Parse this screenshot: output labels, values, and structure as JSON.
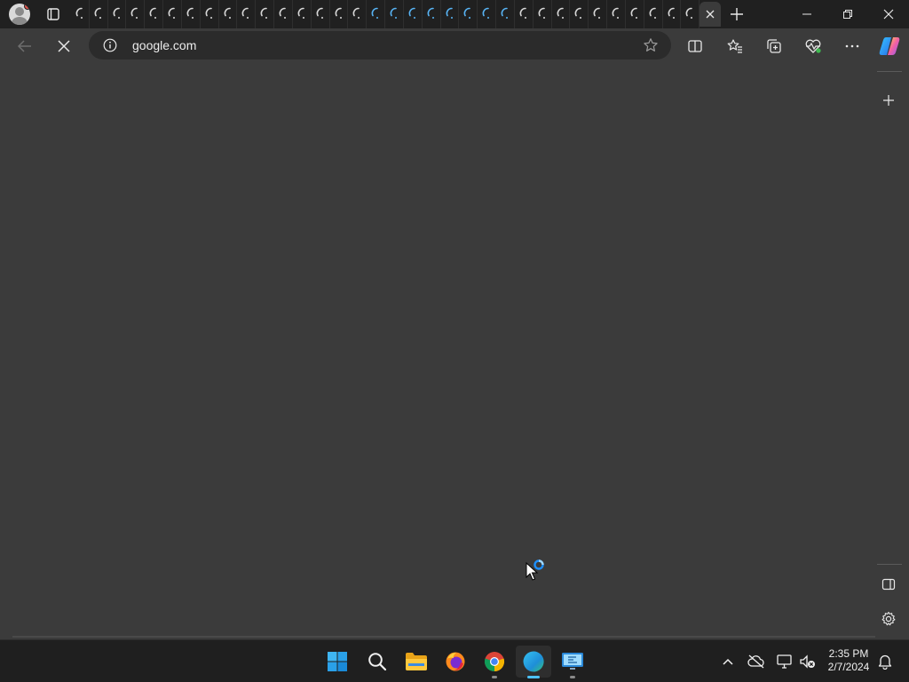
{
  "browser": {
    "address": {
      "url": "google.com"
    },
    "tab_count": 34,
    "accent_color": "#4cc2ff"
  },
  "taskbar": {
    "apps": [
      "start-icon",
      "search-icon",
      "file-explorer-icon",
      "firefox-icon",
      "chrome-icon",
      "edge-icon",
      "remote-desktop-icon"
    ],
    "clock": {
      "time": "2:35 PM",
      "date": "2/7/2024"
    }
  }
}
